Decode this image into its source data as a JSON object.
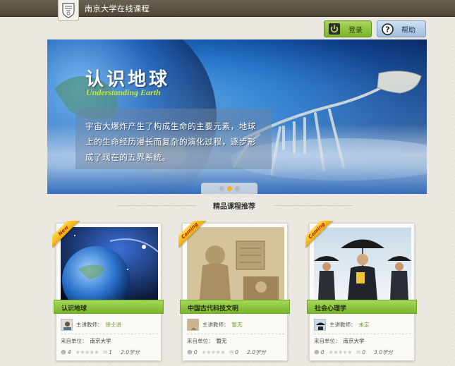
{
  "header": {
    "site_title": "南京大学在线课程",
    "logo_icon": "university-crest-icon"
  },
  "toolbar": {
    "login_label": "登录",
    "login_icon": "power-icon",
    "help_label": "帮助",
    "help_icon": "question-icon"
  },
  "banner": {
    "title": "认识地球",
    "subtitle": "Understanding Earth",
    "text": "宇宙大爆炸产生了构成生命的主要元素，地球上的生命经历漫长而复杂的演化过程，逐步形成了现在的五界系统。",
    "slides": 3,
    "active_slide": 2
  },
  "section": {
    "title": "精品课程推荐"
  },
  "labels": {
    "teacher": "主讲教师：",
    "unit": "来自单位："
  },
  "courses": [
    {
      "badge": "New",
      "name": "认识地球",
      "teacher": "徐士进",
      "unit": "南京大学",
      "learners": "4",
      "comments": "1",
      "credits": "2.0学分",
      "image": "earth-space"
    },
    {
      "badge": "Coming",
      "name": "中国古代科技文明",
      "teacher": "暂无",
      "unit": "暂无",
      "learners": "0",
      "comments": "0",
      "credits": "2.0学分",
      "image": "stone-relief"
    },
    {
      "badge": "Coming",
      "name": "社会心理学",
      "teacher": "未定",
      "unit": "南京大学",
      "learners": "0",
      "comments": "0",
      "credits": "3.0学分",
      "image": "umbrella-businessmen"
    }
  ],
  "colors": {
    "accent_green": "#7bb52b",
    "header_brown": "#5a5243",
    "badge_gold": "#f0a90c"
  }
}
